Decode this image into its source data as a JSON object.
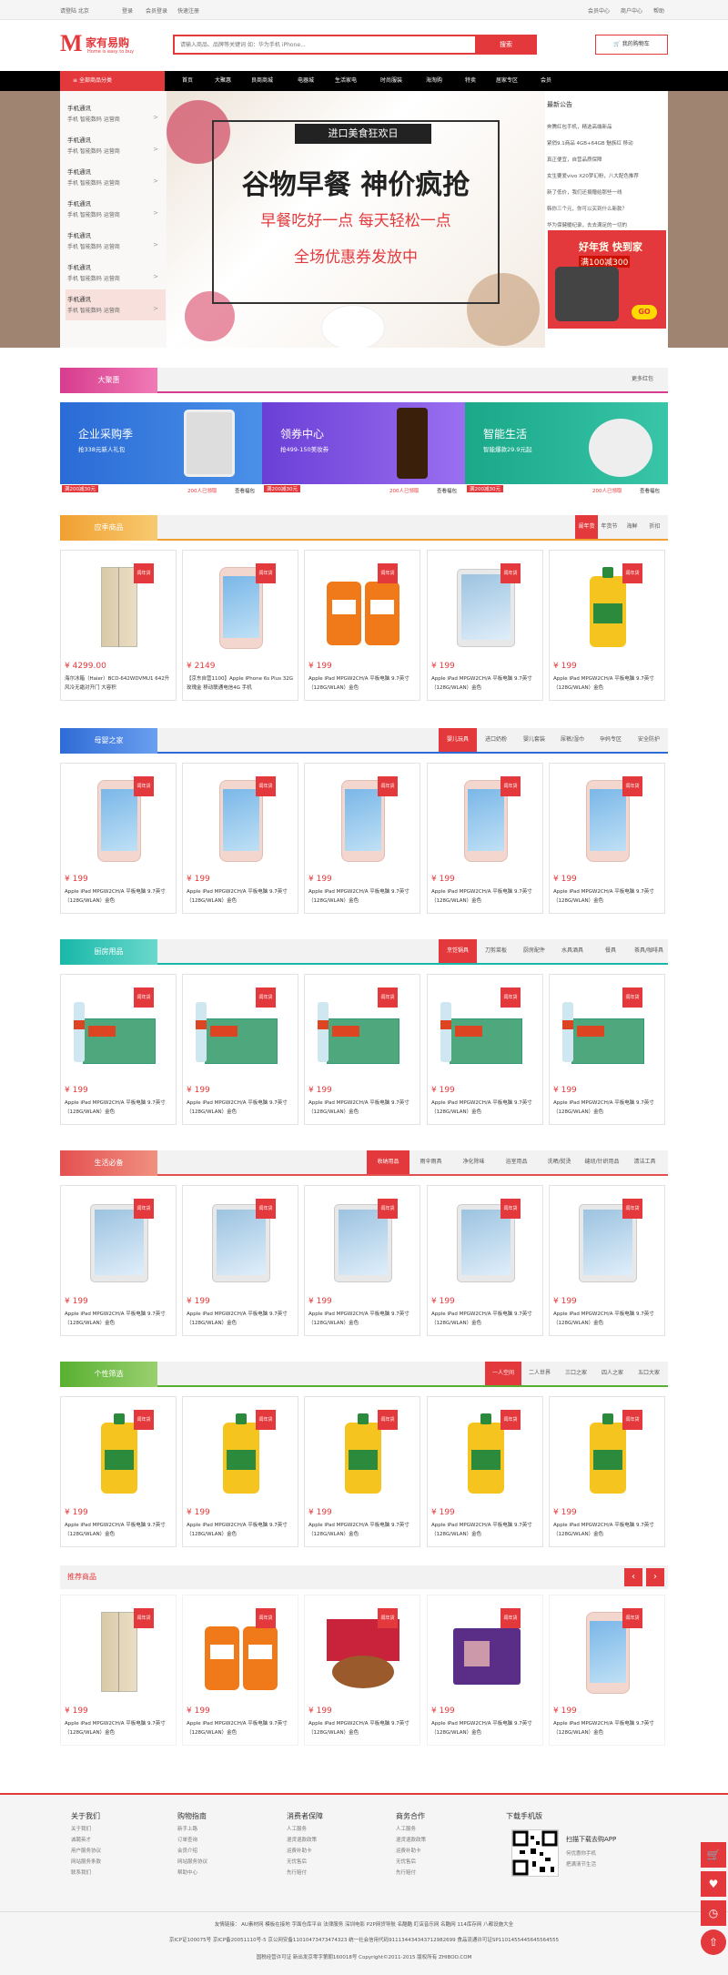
{
  "topbar": {
    "welcome": "请登陆 北京",
    "login": "登录",
    "register": "会员登录",
    "quick": "快速注册",
    "member": "会员中心",
    "merchant": "商户中心",
    "help": "帮助"
  },
  "logo": {
    "text": "家有易购",
    "slogan": "Home is easy to buy"
  },
  "search": {
    "placeholder": "请输入商品、品牌等关键词 如：华为手机 iPhone...",
    "button": "搜索"
  },
  "cart": {
    "label": "我的购物车"
  },
  "nav": {
    "category": "全部商品分类",
    "items": [
      "首页",
      "大聚惠",
      "良商商城",
      "电器城",
      "生活家电",
      "时尚服装",
      "海淘购",
      "特卖",
      "居家专区",
      "会员"
    ]
  },
  "left_menu": [
    {
      "title": "手机通讯",
      "sub": "手机  智能数码  运营商"
    },
    {
      "title": "手机通讯",
      "sub": "手机  智能数码  运营商"
    },
    {
      "title": "手机通讯",
      "sub": "手机  智能数码  运营商"
    },
    {
      "title": "手机通讯",
      "sub": "手机  智能数码  运营商"
    },
    {
      "title": "手机通讯",
      "sub": "手机  智能数码  运营商"
    },
    {
      "title": "手机通讯",
      "sub": "手机  智能数码  运营商"
    },
    {
      "title": "手机通讯",
      "sub": "手机  智能数码  运营商"
    }
  ],
  "hero": {
    "banner": "进口美食狂欢日",
    "headline": "谷物早餐 神价疯抢",
    "sub": "早餐吃好一点  每天轻松一点",
    "coupon": "全场优惠券发放中"
  },
  "news": {
    "title": "最新公告",
    "items": [
      "奔腾红包手机，精选高端新品",
      "紧俏9.1商品 4GB+64GB 魅族红 移动",
      "真正便宜，自营品质保障",
      "女生要爱vivo X20梦幻粉，八大配色推荐",
      "新了低价，我们还捐赠给那些一线",
      "韩你三个元，你可以买到什么新款？",
      "华为保健暖纪录，去去满足的一切的"
    ],
    "ad_1": "好年货 快到家",
    "ad_2": "满100减300",
    "ad_go": "GO"
  },
  "sections": {
    "jubao": {
      "title": "大聚惠",
      "more": "更多红包"
    },
    "season": {
      "title": "应季商品",
      "tabs": [
        "闺年货",
        "年货节",
        "海鲜",
        "折扣"
      ]
    },
    "baby": {
      "title": "母婴之家",
      "tabs": [
        "婴儿玩具",
        "进口奶粉",
        "婴儿套装",
        "尿裤/湿巾",
        "孕妈专区",
        "安全防护"
      ]
    },
    "kitchen": {
      "title": "厨房用品",
      "tabs": [
        "烹饪锅具",
        "刀剪菜板",
        "厨房配件",
        "水具酒具",
        "餐具",
        "茶具/咖啡具"
      ]
    },
    "life": {
      "title": "生活必备",
      "tabs": [
        "收纳用品",
        "雨伞雨具",
        "净化除味",
        "浴室用品",
        "洗晒/熨烫",
        "缝纫/针织用品",
        "清洁工具"
      ]
    },
    "personal": {
      "title": "个性筛选",
      "tabs": [
        "一人空间",
        "二人世界",
        "三口之家",
        "四人之家",
        "五口大家"
      ]
    },
    "recommend": {
      "title": "推荐商品"
    }
  },
  "promos": [
    {
      "title": "企业采购季",
      "sub": "抢338元新人礼包",
      "badge": "满200减30元",
      "foot": "200人已领取",
      "link": "查看福包"
    },
    {
      "title": "领券中心",
      "sub": "抢499-150美妆券",
      "badge": "满200减30元",
      "foot": "200人已领取",
      "link": "查看福包"
    },
    {
      "title": "智能生活",
      "sub": "智能爆款29.9元起",
      "badge": "满200减30元",
      "foot": "200人已领取",
      "link": "查看福包"
    }
  ],
  "badge": "闺年货",
  "product": {
    "price": "¥ 199",
    "name": "Apple iPad MPGW2CH/A 平板电脑 9.7英寸（128G/WLAN）金色"
  },
  "season_first": [
    {
      "price": "¥ 4299.00",
      "name": "海尔冰箱（Haier）BCD-642WDVMU1 642升风冷无霜对开门 大容积"
    },
    {
      "price": "¥ 2149",
      "name": "【京东自营1100】Apple iPhone 6s Plus 32G 玫瑰金 移动联通电信4G 手机"
    }
  ],
  "footer": {
    "cols": [
      {
        "h": "关于我们",
        "l": [
          "关于我们",
          "诚聘英才",
          "用户服务协议",
          "网站服务条款",
          "联系我们"
        ]
      },
      {
        "h": "购物指南",
        "l": [
          "新手上路",
          "订单查询",
          "会员介绍",
          "网站服务协议",
          "帮助中心"
        ]
      },
      {
        "h": "消费者保障",
        "l": [
          "人工服务",
          "退货退款政策",
          "运费补助卡",
          "无忧售后",
          "先行赔付"
        ]
      },
      {
        "h": "商务合作",
        "l": [
          "人工服务",
          "退货退款政策",
          "运费补助卡",
          "无忧售后",
          "先行赔付"
        ]
      }
    ],
    "app": "下载手机版",
    "app_title": "扫描下载去购APP",
    "app_l": [
      "何优惠你手机",
      "把满清节生活"
    ],
    "links": "友情链接：  AU素材网  模板在接地 字面仓库平台 法律服务 深圳电影 P2P网贷导航 名酷酷 盯店音乐网 名酷网 114库存网 八都设施大全",
    "icp": "京ICP证100075号 京ICP备20051110号-5 京公网安备11010473473474323 统一社会信用代码911134434343712982699 食品流通许可证SP1101455445645564555",
    "copy": "国税经营许可证 新出发京零字第朝160018号 Copyright©2011-2015 版权所有 ZHIBOO.COM"
  }
}
